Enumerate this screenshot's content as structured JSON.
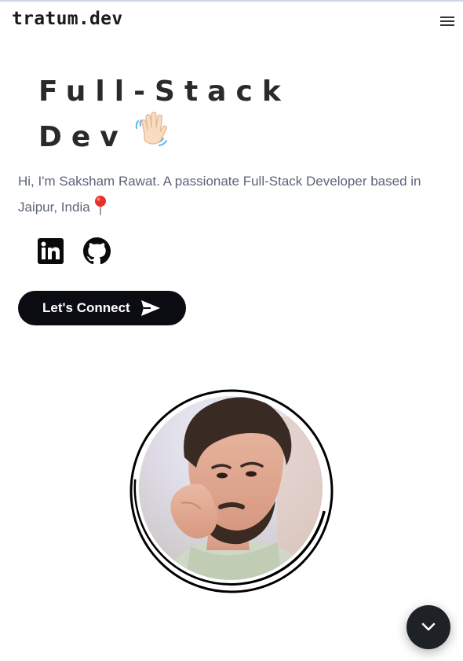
{
  "header": {
    "brand": "tratum.dev",
    "menu_icon": "hamburger-menu-icon"
  },
  "hero": {
    "title_line1": "Full-Stack",
    "title_line2": "Dev",
    "title_emoji_icon": "waving-hand-icon",
    "intro_text": "Hi, I'm Saksham Rawat. A passionate Full-Stack Developer based in Jaipur, India",
    "location_icon": "pushpin-icon"
  },
  "socials": [
    {
      "icon": "linkedin-icon"
    },
    {
      "icon": "github-icon"
    }
  ],
  "cta": {
    "label": "Let's Connect",
    "icon": "send-icon"
  },
  "profile": {
    "image_icon": "profile-photo"
  },
  "fab": {
    "icon": "chevron-down-icon"
  },
  "colors": {
    "text_primary": "#2a2a2a",
    "text_muted": "#5b6478",
    "button_bg": "#0b0b12",
    "fab_bg": "#1e2126"
  }
}
